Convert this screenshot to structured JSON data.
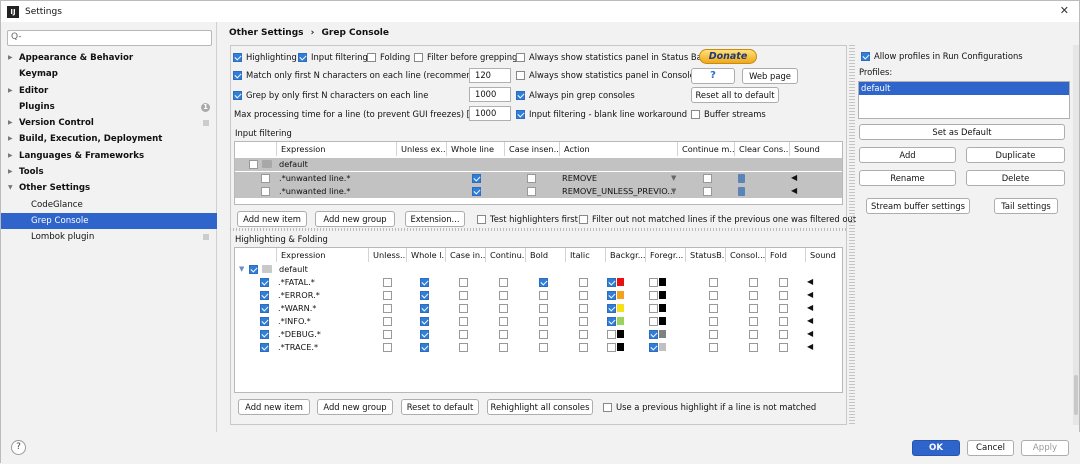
{
  "window": {
    "title": "Settings",
    "app_icon": "IJ"
  },
  "search": {
    "placeholder": ""
  },
  "sidebar": {
    "items": [
      {
        "label": "Appearance & Behavior"
      },
      {
        "label": "Keymap"
      },
      {
        "label": "Editor"
      },
      {
        "label": "Plugins"
      },
      {
        "label": "Version Control"
      },
      {
        "label": "Build, Execution, Deployment"
      },
      {
        "label": "Languages & Frameworks"
      },
      {
        "label": "Tools"
      },
      {
        "label": "Other Settings"
      },
      {
        "label": "CodeGlance"
      },
      {
        "label": "Grep Console"
      },
      {
        "label": "Lombok plugin"
      }
    ],
    "plugins_badge": "1"
  },
  "breadcrumb": {
    "parent": "Other Settings",
    "sep": "›",
    "current": "Grep Console"
  },
  "options": {
    "highlighting": "Highlighting",
    "input_filtering": "Input filtering",
    "folding": "Folding",
    "filter_before_grepping": "Filter before grepping",
    "stats_status_bar": "Always show statistics panel in Status Bar",
    "match_only": "Match only first N characters on each line (recommended)",
    "match_only_value": "120",
    "stats_console": "Always show statistics panel in Console",
    "grep_only": "Grep by only first N characters on each line",
    "grep_only_value": "1000",
    "pin_consoles": "Always pin grep consoles",
    "max_processing": "Max processing time for a line (to prevent GUI freezes) [ms]",
    "max_processing_value": "1000",
    "blank_line": "Input filtering - blank line workaround",
    "buffer_streams": "Buffer streams"
  },
  "buttons": {
    "donate": "Donate",
    "help": "?",
    "web_page": "Web page",
    "reset_all": "Reset all to default",
    "add_new_item": "Add new item",
    "add_new_group": "Add new group",
    "extension": "Extension...",
    "add_new_item2": "Add new item",
    "add_new_group2": "Add new group",
    "reset_default": "Reset to default",
    "rehighlight": "Rehighlight all consoles",
    "ok": "OK",
    "cancel": "Cancel",
    "apply": "Apply"
  },
  "input_filtering": {
    "title": "Input filtering",
    "headers": [
      "Expression",
      "Unless ex...",
      "Whole line",
      "Case insen...",
      "Action",
      "Continue m...",
      "Clear Cons...",
      "Sound"
    ],
    "rows": [
      {
        "expression": "default",
        "action": "",
        "whole": false
      },
      {
        "expression": ".*unwanted line.*",
        "action": "REMOVE",
        "whole": true
      },
      {
        "expression": ".*unwanted line.*",
        "action": "REMOVE_UNLESS_PREVIO...",
        "whole": true
      }
    ],
    "test_highlighters": "Test highlighters first",
    "filter_out": "Filter out not matched lines if the previous one was filtered out"
  },
  "highlighting": {
    "title": "Highlighting & Folding",
    "headers": [
      "Expression",
      "Unless...",
      "Whole l...",
      "Case in...",
      "Continu...",
      "Bold",
      "Italic",
      "Backgr...",
      "Foregr...",
      "StatusB...",
      "Consol...",
      "Fold",
      "Sound"
    ],
    "group": "default",
    "rows": [
      {
        "expression": ".*FATAL.*",
        "bold": true,
        "bg": "#e81010",
        "fg": "#000000",
        "bgon": true,
        "fgon": false
      },
      {
        "expression": ".*ERROR.*",
        "bold": false,
        "bg": "#f2a11a",
        "fg": "#000000",
        "bgon": true,
        "fgon": false
      },
      {
        "expression": ".*WARN.*",
        "bold": false,
        "bg": "#f5e11a",
        "fg": "#000000",
        "bgon": true,
        "fgon": false
      },
      {
        "expression": ".*INFO.*",
        "bold": false,
        "bg": "#9ad45a",
        "fg": "#000000",
        "bgon": true,
        "fgon": false
      },
      {
        "expression": ".*DEBUG.*",
        "bold": false,
        "bg": "#000000",
        "fg": "#808080",
        "bgon": false,
        "fgon": true
      },
      {
        "expression": ".*TRACE.*",
        "bold": false,
        "bg": "#000000",
        "fg": "#c0c0c0",
        "bgon": false,
        "fgon": true
      }
    ],
    "previous_highlight": "Use a previous highlight if a line is not matched"
  },
  "profiles": {
    "allow": "Allow profiles in Run Configurations",
    "label": "Profiles:",
    "selected": "default",
    "set_default": "Set as Default",
    "add": "Add",
    "duplicate": "Duplicate",
    "rename": "Rename",
    "delete": "Delete",
    "stream_buffer": "Stream buffer settings",
    "tail": "Tail settings"
  }
}
